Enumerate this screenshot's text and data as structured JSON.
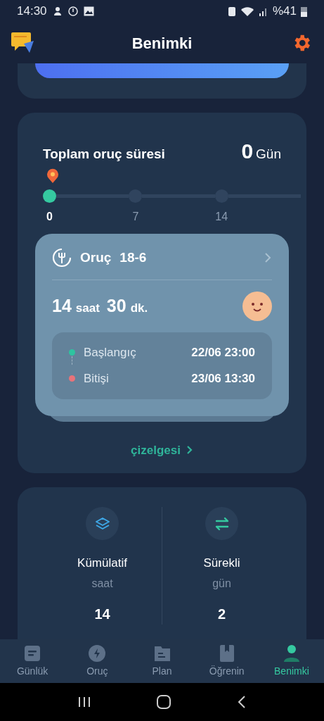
{
  "status_bar": {
    "time": "14:30",
    "battery": "%41"
  },
  "header": {
    "title": "Benimki"
  },
  "total": {
    "label": "Toplam oruç süresi",
    "value": "0",
    "unit": "Gün",
    "ticks": [
      {
        "label": "0",
        "reached": true
      },
      {
        "label": "7",
        "reached": false
      },
      {
        "label": "14",
        "reached": false
      }
    ]
  },
  "fast_card": {
    "title": "Oruç",
    "plan": "18-6",
    "hours": "14",
    "hours_unit": "saat",
    "minutes": "30",
    "minutes_unit": "dk.",
    "times": [
      {
        "kind": "start",
        "label": "Başlangıç",
        "value": "22/06 23:00",
        "color": "#2ec4a0"
      },
      {
        "kind": "end",
        "label": "Bitişi",
        "value": "23/06 13:30",
        "color": "#e8737a"
      }
    ]
  },
  "chart_link": "çizelgesi",
  "stats": [
    {
      "kind": "cumulative",
      "label": "Kümülatif",
      "unit": "saat",
      "value": "14"
    },
    {
      "kind": "streak",
      "label": "Sürekli",
      "unit": "gün",
      "value": "2"
    }
  ],
  "nav": [
    {
      "kind": "diary",
      "label": "Günlük",
      "selected": false
    },
    {
      "kind": "fast",
      "label": "Oruç",
      "selected": false
    },
    {
      "kind": "plan",
      "label": "Plan",
      "selected": false
    },
    {
      "kind": "learn",
      "label": "Öğrenin",
      "selected": false
    },
    {
      "kind": "me",
      "label": "Benimki",
      "selected": true
    }
  ]
}
